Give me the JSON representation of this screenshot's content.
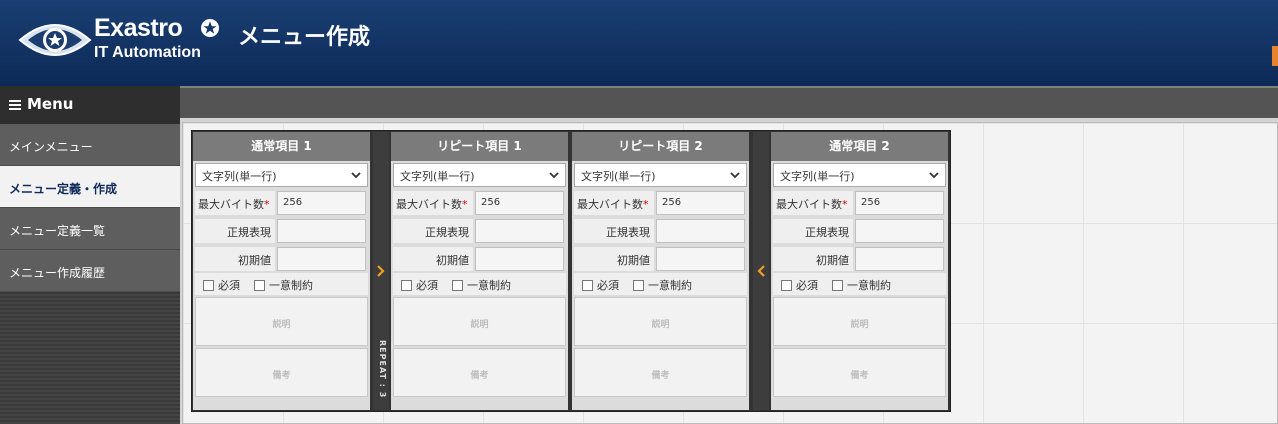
{
  "app": {
    "logo_word": "Exastro",
    "logo_sub": "IT Automation",
    "page_title": "メニュー作成"
  },
  "sidebar": {
    "title": "Menu",
    "items": [
      {
        "label": "メインメニュー",
        "active": false
      },
      {
        "label": "メニュー定義・作成",
        "active": true
      },
      {
        "label": "メニュー定義一覧",
        "active": false
      },
      {
        "label": "メニュー作成履歴",
        "active": false
      }
    ]
  },
  "columns": [
    {
      "title": "通常項目 1",
      "type": "文字列(単一行)",
      "max_bytes_label": "最大バイト数",
      "max_bytes": "256",
      "regex_label": "正規表現",
      "regex": "",
      "default_label": "初期値",
      "default": "",
      "required_label": "必須",
      "unique_label": "一意制約",
      "desc_placeholder": "説明",
      "note_placeholder": "備考"
    },
    {
      "title": "リピート項目 1",
      "type": "文字列(単一行)",
      "max_bytes_label": "最大バイト数",
      "max_bytes": "256",
      "regex_label": "正規表現",
      "regex": "",
      "default_label": "初期値",
      "default": "",
      "required_label": "必須",
      "unique_label": "一意制約",
      "desc_placeholder": "説明",
      "note_placeholder": "備考"
    },
    {
      "title": "リピート項目 2",
      "type": "文字列(単一行)",
      "max_bytes_label": "最大バイト数",
      "max_bytes": "256",
      "regex_label": "正規表現",
      "regex": "",
      "default_label": "初期値",
      "default": "",
      "required_label": "必須",
      "unique_label": "一意制約",
      "desc_placeholder": "説明",
      "note_placeholder": "備考"
    },
    {
      "title": "通常項目 2",
      "type": "文字列(単一行)",
      "max_bytes_label": "最大バイト数",
      "max_bytes": "256",
      "regex_label": "正規表現",
      "regex": "",
      "default_label": "初期値",
      "default": "",
      "required_label": "必須",
      "unique_label": "一意制約",
      "desc_placeholder": "説明",
      "note_placeholder": "備考"
    }
  ],
  "repeat": {
    "label": "REPEAT : 3"
  },
  "colors": {
    "header": "#123363",
    "accent_arrow": "#f0a020",
    "required_mark": "#dd0000"
  }
}
